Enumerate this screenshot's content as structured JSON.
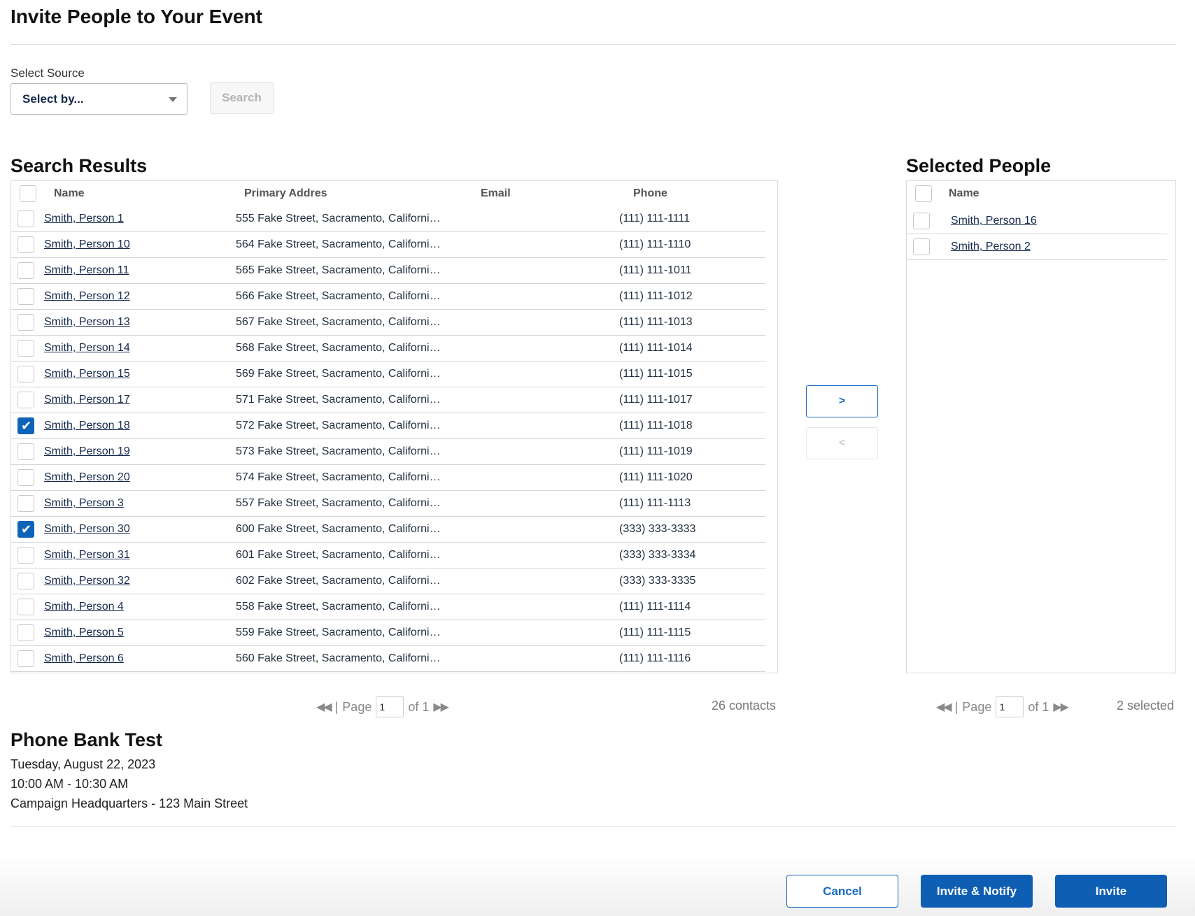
{
  "page": {
    "title": "Invite People to Your Event"
  },
  "source": {
    "label": "Select Source",
    "select_value": "Select by...",
    "search_label": "Search"
  },
  "search_results": {
    "title": "Search Results",
    "columns": [
      "Name",
      "Primary Addres",
      "Email",
      "Phone"
    ],
    "rows": [
      {
        "name": "Smith, Person 1",
        "address": "555 Fake Street, Sacramento, Californi…",
        "email": "",
        "phone": "(111) 111-1111",
        "checked": false
      },
      {
        "name": "Smith, Person 10",
        "address": "564 Fake Street, Sacramento, Californi…",
        "email": "",
        "phone": "(111) 111-1110",
        "checked": false
      },
      {
        "name": "Smith, Person 11",
        "address": "565 Fake Street, Sacramento, Californi…",
        "email": "",
        "phone": "(111) 111-1011",
        "checked": false
      },
      {
        "name": "Smith, Person 12",
        "address": "566 Fake Street, Sacramento, Californi…",
        "email": "",
        "phone": "(111) 111-1012",
        "checked": false
      },
      {
        "name": "Smith, Person 13",
        "address": "567 Fake Street, Sacramento, Californi…",
        "email": "",
        "phone": "(111) 111-1013",
        "checked": false
      },
      {
        "name": "Smith, Person 14",
        "address": "568 Fake Street, Sacramento, Californi…",
        "email": "",
        "phone": "(111) 111-1014",
        "checked": false
      },
      {
        "name": "Smith, Person 15",
        "address": "569 Fake Street, Sacramento, Californi…",
        "email": "",
        "phone": "(111) 111-1015",
        "checked": false
      },
      {
        "name": "Smith, Person 17",
        "address": "571 Fake Street, Sacramento, Californi…",
        "email": "",
        "phone": "(111) 111-1017",
        "checked": false
      },
      {
        "name": "Smith, Person 18",
        "address": "572 Fake Street, Sacramento, Californi…",
        "email": "",
        "phone": "(111) 111-1018",
        "checked": true
      },
      {
        "name": "Smith, Person 19",
        "address": "573 Fake Street, Sacramento, Californi…",
        "email": "",
        "phone": "(111) 111-1019",
        "checked": false
      },
      {
        "name": "Smith, Person 20",
        "address": "574 Fake Street, Sacramento, Californi…",
        "email": "",
        "phone": "(111) 111-1020",
        "checked": false
      },
      {
        "name": "Smith, Person 3",
        "address": "557 Fake Street, Sacramento, Californi…",
        "email": "",
        "phone": "(111) 111-1113",
        "checked": false
      },
      {
        "name": "Smith, Person 30",
        "address": "600 Fake Street, Sacramento, Californi…",
        "email": "",
        "phone": "(333) 333-3333",
        "checked": true
      },
      {
        "name": "Smith, Person 31",
        "address": "601 Fake Street, Sacramento, Californi…",
        "email": "",
        "phone": "(333) 333-3334",
        "checked": false
      },
      {
        "name": "Smith, Person 32",
        "address": "602 Fake Street, Sacramento, Californi…",
        "email": "",
        "phone": "(333) 333-3335",
        "checked": false
      },
      {
        "name": "Smith, Person 4",
        "address": "558 Fake Street, Sacramento, Californi…",
        "email": "",
        "phone": "(111) 111-1114",
        "checked": false
      },
      {
        "name": "Smith, Person 5",
        "address": "559 Fake Street, Sacramento, Californi…",
        "email": "",
        "phone": "(111) 111-1115",
        "checked": false
      },
      {
        "name": "Smith, Person 6",
        "address": "560 Fake Street, Sacramento, Californi…",
        "email": "",
        "phone": "(111) 111-1116",
        "checked": false
      }
    ],
    "pager": {
      "page_label": "Page",
      "page_value": "1",
      "of_label": "of 1"
    },
    "count": "26 contacts"
  },
  "transfer": {
    "add_label": ">",
    "remove_label": "<"
  },
  "selected_people": {
    "title": "Selected People",
    "columns": [
      "Name"
    ],
    "rows": [
      {
        "name": "Smith, Person 16",
        "checked": false
      },
      {
        "name": "Smith, Person 2",
        "checked": false
      }
    ],
    "pager": {
      "page_label": "Page",
      "page_value": "1",
      "of_label": "of 1"
    },
    "count": "2 selected"
  },
  "event": {
    "title": "Phone Bank Test",
    "date": "Tuesday, August 22, 2023",
    "time": "10:00 AM - 10:30 AM",
    "location": "Campaign Headquarters - 123 Main Street"
  },
  "footer": {
    "cancel_label": "Cancel",
    "invite_notify_label": "Invite & Notify",
    "invite_label": "Invite"
  },
  "colors": {
    "accent": "#0e5fb4",
    "link": "#13294b",
    "checkbox_checked": "#0d64b8"
  }
}
